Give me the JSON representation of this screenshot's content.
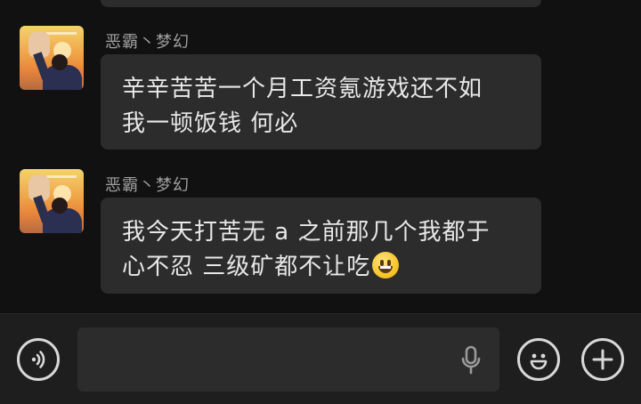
{
  "messages": [
    {
      "sender": "恶霸丶梦幻",
      "lines": [
        "辛辛苦苦一个月工资氪游戏还不如",
        "我一顿饭钱 何必"
      ]
    },
    {
      "sender": "恶霸丶梦幻",
      "lines": [
        "我今天打苦无 a 之前那几个我都于",
        "心不忍 三级矿都不让吃"
      ],
      "emoji": "grinning-face"
    }
  ],
  "input": {
    "placeholder": "",
    "value": ""
  },
  "icons": {
    "voice": "voice-mode-icon",
    "mic": "microphone-icon",
    "emoji": "emoji-icon",
    "plus": "plus-icon"
  },
  "colors": {
    "background": "#111111",
    "bubble": "#2c2c2c",
    "toolbar": "#1e1e1e",
    "text": "#e8e8e8",
    "sender": "#a0a0a0"
  }
}
